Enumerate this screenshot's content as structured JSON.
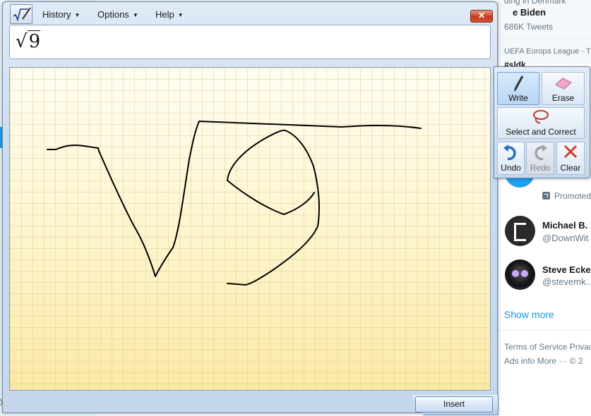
{
  "background": {
    "trend_header": "ding in Denmark",
    "trend_name": "e Biden",
    "trend_count": "686K Tweets",
    "trend2_context": "UEFA Europa League · Tr",
    "trend2_tag": "#sldk",
    "promoted": "Promoted",
    "follow1_name": "Michael B.",
    "follow1_handle": "@DownWit",
    "follow2_name": "Steve Eckel",
    "follow2_handle": "@stevemk...",
    "show_more": "Show more",
    "footer_line1": "Terms of Service  Privac",
    "footer_line2": "Ads info  More ···  © 2",
    "left_fragment": "yk",
    "accent_color": "#1da1f2"
  },
  "window": {
    "menu": {
      "history": "History",
      "options": "Options",
      "help": "Help"
    },
    "close_symbol": "✕",
    "preview": {
      "radical": "√",
      "radicand": "9"
    },
    "insert_label": "Insert"
  },
  "tools": {
    "write": "Write",
    "erase": "Erase",
    "select_correct": "Select and Correct",
    "undo": "Undo",
    "redo": "Redo",
    "clear": "Clear"
  },
  "icons": {
    "app": "math-input-panel-icon",
    "write": "pen-icon",
    "erase": "eraser-icon",
    "select": "lasso-icon",
    "undo": "undo-arrow-icon",
    "redo": "redo-arrow-icon",
    "clear": "x-icon"
  }
}
